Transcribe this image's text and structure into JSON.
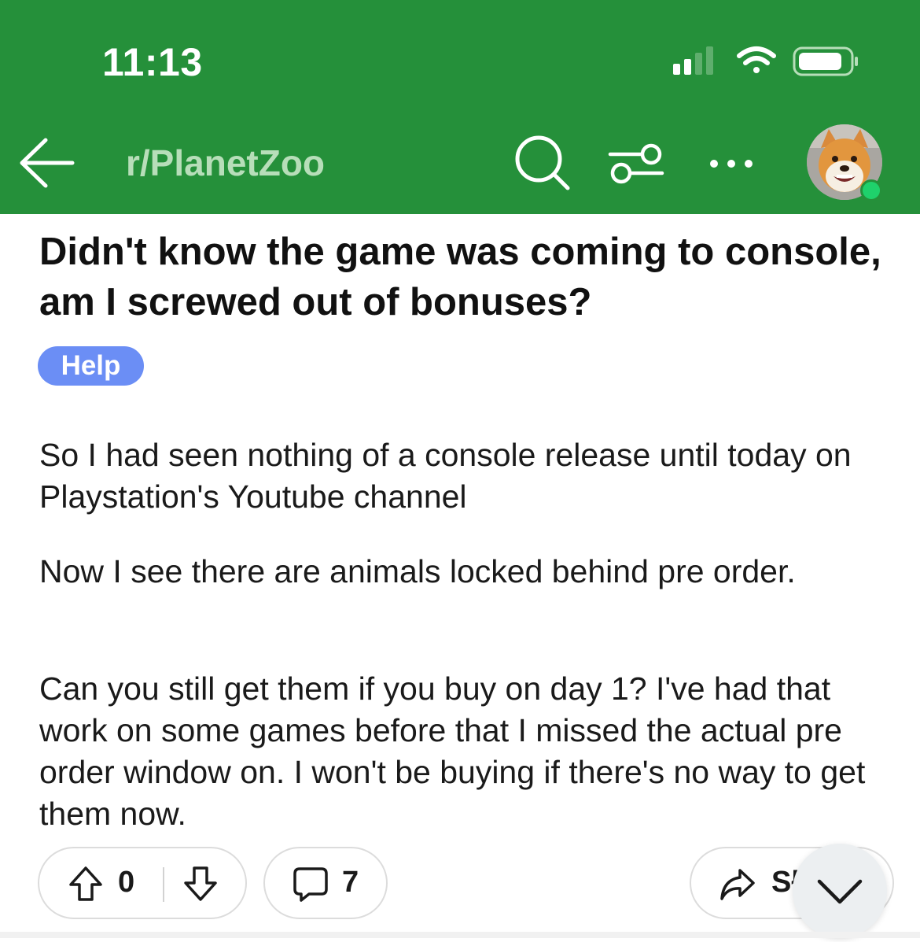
{
  "status_bar": {
    "time": "11:13"
  },
  "header": {
    "subreddit": "r/PlanetZoo",
    "icons": [
      "back-arrow-icon",
      "search-icon",
      "filter-icon",
      "more-icon",
      "avatar"
    ]
  },
  "post": {
    "title": "Didn't know the game was coming to console, am I screwed out of bonuses?",
    "flair": "Help",
    "paragraphs": [
      "So I had seen nothing of a console release until today on Playstation's Youtube channel",
      "Now I see there are animals locked behind pre order.",
      "Can you still get them if you buy on day 1? I've had that work on some games before that I missed the actual pre order window on. I won't be buying if there's no way to get them now."
    ]
  },
  "actions": {
    "vote_count": "0",
    "comment_count": "7",
    "share_label": "Sł"
  },
  "colors": {
    "header_bg": "#25903a",
    "flair_bg": "#6b8ef5",
    "online_dot": "#1fd16b"
  }
}
